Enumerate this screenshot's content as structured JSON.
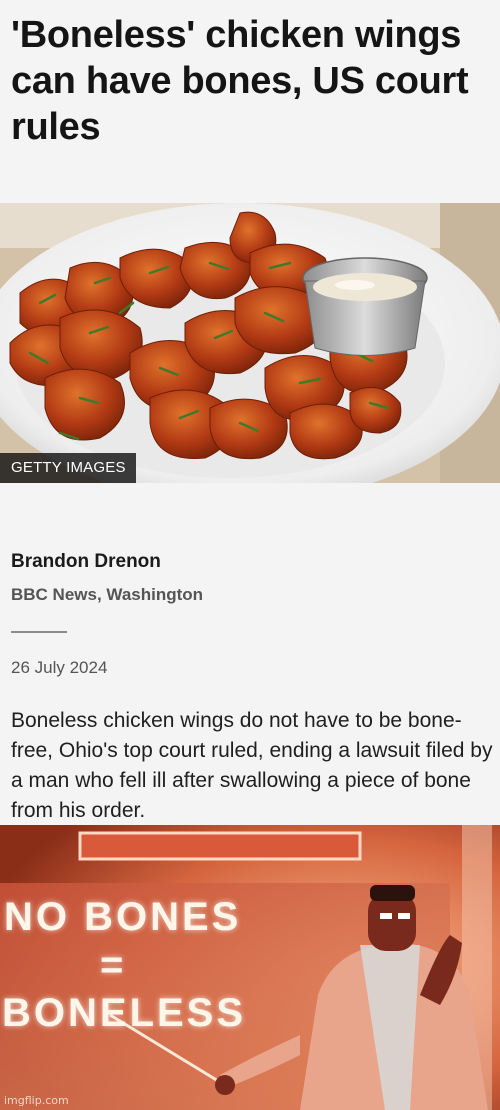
{
  "article": {
    "headline": "'Boneless' chicken wings can have bones, US court rules",
    "image_caption": "GETTY IMAGES",
    "author": "Brandon Drenon",
    "source": "BBC News, Washington",
    "date": "26 July 2024",
    "body": "Boneless chicken wings do not have to be bone-free, Ohio's top court ruled, ending a lawsuit filed by a man who fell ill after swallowing a piece of bone from his order."
  },
  "meme": {
    "line1": "NO BONES",
    "line2": "=",
    "line3": "BONELESS",
    "watermark": "imgflip.com"
  },
  "colors": {
    "background": "#f4f4f4",
    "meme_bg": "#c9603f",
    "wing_sauce": "#b23a14"
  }
}
